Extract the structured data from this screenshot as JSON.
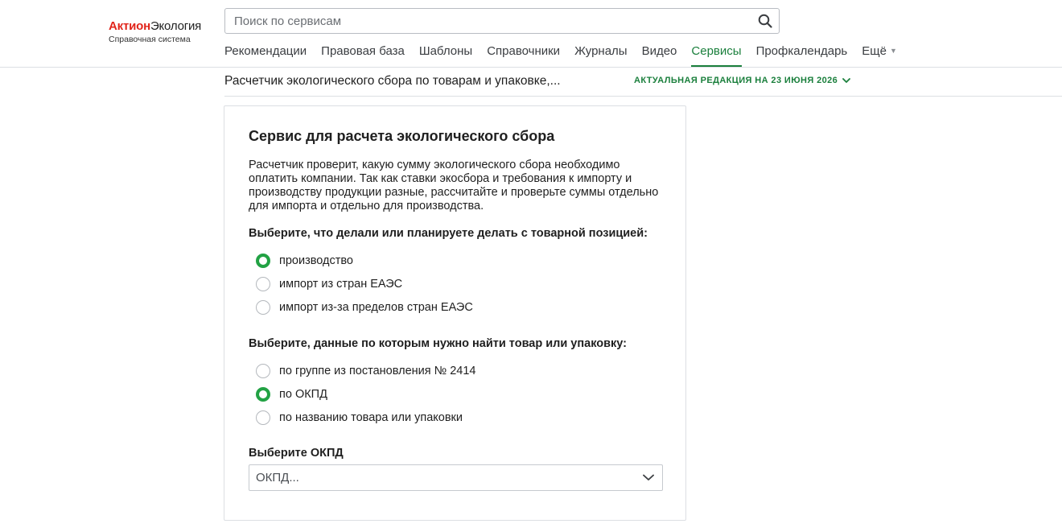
{
  "logo": {
    "brand_part1": "Актион",
    "brand_part2": "Экология",
    "tagline": "Справочная система"
  },
  "search": {
    "placeholder": "Поиск по сервисам",
    "icon": "search-icon"
  },
  "nav": {
    "items": [
      {
        "label": "Рекомендации",
        "active": false
      },
      {
        "label": "Правовая база",
        "active": false
      },
      {
        "label": "Шаблоны",
        "active": false
      },
      {
        "label": "Справочники",
        "active": false
      },
      {
        "label": "Журналы",
        "active": false
      },
      {
        "label": "Видео",
        "active": false
      },
      {
        "label": "Сервисы",
        "active": true
      },
      {
        "label": "Профкалендарь",
        "active": false
      }
    ],
    "more_label": "Ещё"
  },
  "document": {
    "title": "Расчетчик экологического сбора по товарам и упаковке,...",
    "edition": "АКТУАЛЬНАЯ РЕДАКЦИЯ НА 23 ИЮНЯ 2026"
  },
  "service": {
    "title": "Сервис для расчета экологического сбора",
    "description": "Расчетчик проверит, какую сумму экологического сбора необходимо оплатить компании. Так как ставки экосбора и требования к импорту и производству продукции разные, рассчитайте и проверьте суммы отдельно для импорта и отдельно для производства.",
    "question1": {
      "label": "Выберите, что делали или планируете делать с товарной позицией:",
      "options": [
        {
          "label": "производство",
          "checked": true
        },
        {
          "label": "импорт из стран ЕАЭС",
          "checked": false
        },
        {
          "label": "импорт из-за пределов стран ЕАЭС",
          "checked": false
        }
      ]
    },
    "question2": {
      "label": "Выберите, данные по которым нужно найти товар или упаковку:",
      "options": [
        {
          "label": "по группе из постановления № 2414",
          "checked": false
        },
        {
          "label": "по ОКПД",
          "checked": true
        },
        {
          "label": "по названию товара или упаковки",
          "checked": false
        }
      ]
    },
    "okpd": {
      "label": "Выберите ОКПД",
      "placeholder": "ОКПД..."
    }
  },
  "colors": {
    "accent_green": "#1a7f3c",
    "radio_green": "#22a244",
    "brand_red": "#e1251b"
  }
}
